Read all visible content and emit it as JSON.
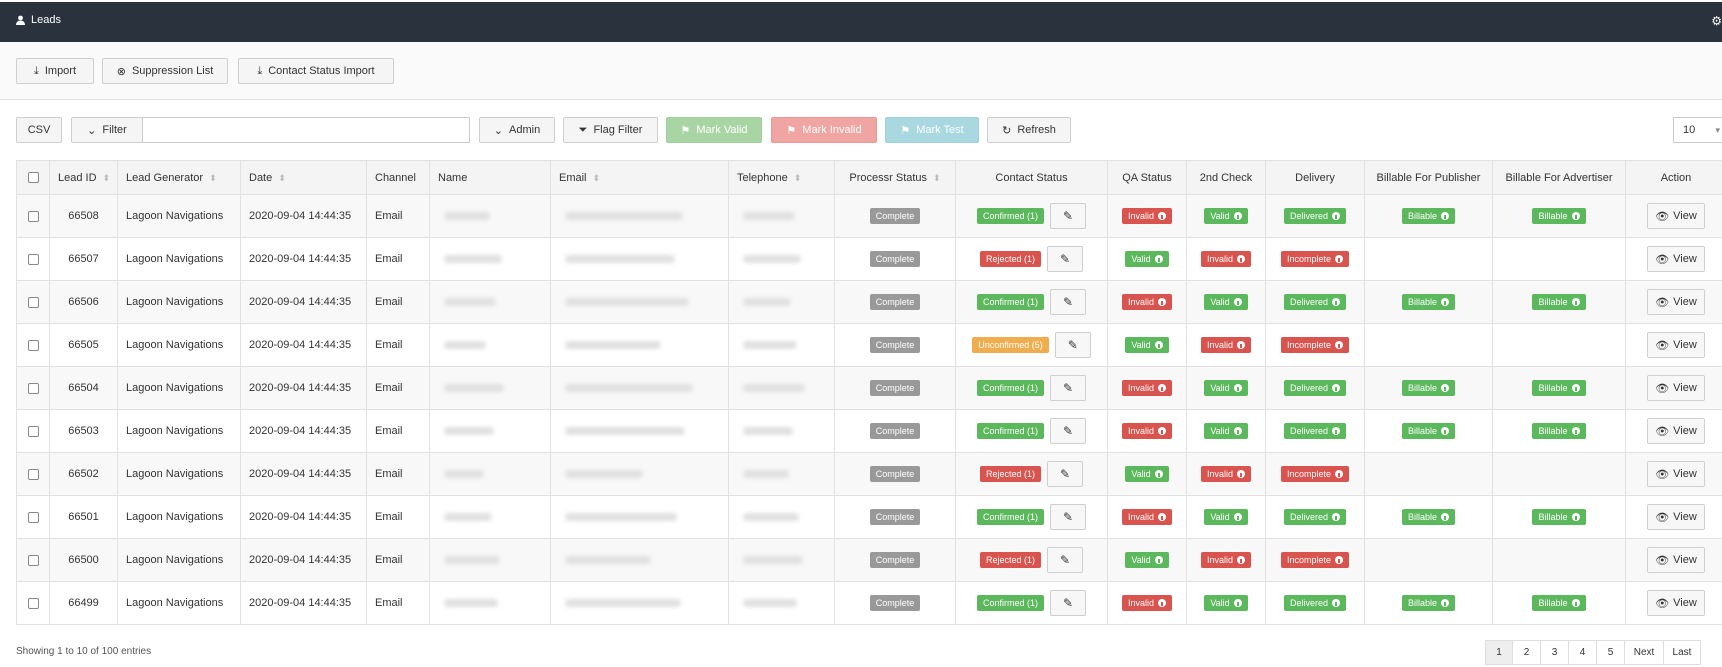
{
  "header": {
    "title": "Leads",
    "user_icon": "user-icon",
    "settings_icon": "gear-icon"
  },
  "actions": {
    "import": "Import",
    "suppression": "Suppression List",
    "contact_status_import": "Contact Status Import"
  },
  "toolbar": {
    "csv": "CSV",
    "filter": "Filter",
    "filter_value": "",
    "admin": "Admin",
    "flag_filter": "Flag Filter",
    "mark_valid": "Mark Valid",
    "mark_invalid": "Mark Invalid",
    "mark_test": "Mark Test",
    "refresh": "Refresh",
    "page_size": "10"
  },
  "colors": {
    "header_bg": "#2a323d",
    "green": "#5cb85c",
    "red": "#d9534f",
    "orange": "#f0ad4e",
    "gray": "#999999"
  },
  "table": {
    "columns": [
      "Lead ID",
      "Lead Generator",
      "Date",
      "Channel",
      "Name",
      "Email",
      "Telephone",
      "Processr Status",
      "Contact Status",
      "QA Status",
      "2nd Check",
      "Delivery",
      "Billable For Publisher",
      "Billable For Advertiser",
      "Action"
    ],
    "rows": [
      {
        "id": "66508",
        "gen": "Lagoon Navigations",
        "date": "2020-09-04 14:44:35",
        "ch": "Email",
        "proc": "Complete",
        "contact": "Confirmed (1)",
        "contact_color": "green",
        "qa": "Invalid",
        "qa_color": "red",
        "check2": "Valid",
        "check2_color": "green",
        "delivery": "Delivered",
        "delivery_color": "green",
        "bill_pub": "Billable",
        "bill_adv": "Billable",
        "action": "View"
      },
      {
        "id": "66507",
        "gen": "Lagoon Navigations",
        "date": "2020-09-04 14:44:35",
        "ch": "Email",
        "proc": "Complete",
        "contact": "Rejected (1)",
        "contact_color": "red",
        "qa": "Valid",
        "qa_color": "green",
        "check2": "Invalid",
        "check2_color": "red",
        "delivery": "Incomplete",
        "delivery_color": "red",
        "bill_pub": "",
        "bill_adv": "",
        "action": "View"
      },
      {
        "id": "66506",
        "gen": "Lagoon Navigations",
        "date": "2020-09-04 14:44:35",
        "ch": "Email",
        "proc": "Complete",
        "contact": "Confirmed (1)",
        "contact_color": "green",
        "qa": "Invalid",
        "qa_color": "red",
        "check2": "Valid",
        "check2_color": "green",
        "delivery": "Delivered",
        "delivery_color": "green",
        "bill_pub": "Billable",
        "bill_adv": "Billable",
        "action": "View"
      },
      {
        "id": "66505",
        "gen": "Lagoon Navigations",
        "date": "2020-09-04 14:44:35",
        "ch": "Email",
        "proc": "Complete",
        "contact": "Unconfirmed (5)",
        "contact_color": "orange",
        "qa": "Valid",
        "qa_color": "green",
        "check2": "Invalid",
        "check2_color": "red",
        "delivery": "Incomplete",
        "delivery_color": "red",
        "bill_pub": "",
        "bill_adv": "",
        "action": "View"
      },
      {
        "id": "66504",
        "gen": "Lagoon Navigations",
        "date": "2020-09-04 14:44:35",
        "ch": "Email",
        "proc": "Complete",
        "contact": "Confirmed (1)",
        "contact_color": "green",
        "qa": "Invalid",
        "qa_color": "red",
        "check2": "Valid",
        "check2_color": "green",
        "delivery": "Delivered",
        "delivery_color": "green",
        "bill_pub": "Billable",
        "bill_adv": "Billable",
        "action": "View"
      },
      {
        "id": "66503",
        "gen": "Lagoon Navigations",
        "date": "2020-09-04 14:44:35",
        "ch": "Email",
        "proc": "Complete",
        "contact": "Confirmed (1)",
        "contact_color": "green",
        "qa": "Invalid",
        "qa_color": "red",
        "check2": "Valid",
        "check2_color": "green",
        "delivery": "Delivered",
        "delivery_color": "green",
        "bill_pub": "Billable",
        "bill_adv": "Billable",
        "action": "View"
      },
      {
        "id": "66502",
        "gen": "Lagoon Navigations",
        "date": "2020-09-04 14:44:35",
        "ch": "Email",
        "proc": "Complete",
        "contact": "Rejected (1)",
        "contact_color": "red",
        "qa": "Valid",
        "qa_color": "green",
        "check2": "Invalid",
        "check2_color": "red",
        "delivery": "Incomplete",
        "delivery_color": "red",
        "bill_pub": "",
        "bill_adv": "",
        "action": "View"
      },
      {
        "id": "66501",
        "gen": "Lagoon Navigations",
        "date": "2020-09-04 14:44:35",
        "ch": "Email",
        "proc": "Complete",
        "contact": "Confirmed (1)",
        "contact_color": "green",
        "qa": "Invalid",
        "qa_color": "red",
        "check2": "Valid",
        "check2_color": "green",
        "delivery": "Delivered",
        "delivery_color": "green",
        "bill_pub": "Billable",
        "bill_adv": "Billable",
        "action": "View"
      },
      {
        "id": "66500",
        "gen": "Lagoon Navigations",
        "date": "2020-09-04 14:44:35",
        "ch": "Email",
        "proc": "Complete",
        "contact": "Rejected (1)",
        "contact_color": "red",
        "qa": "Valid",
        "qa_color": "green",
        "check2": "Invalid",
        "check2_color": "red",
        "delivery": "Incomplete",
        "delivery_color": "red",
        "bill_pub": "",
        "bill_adv": "",
        "action": "View"
      },
      {
        "id": "66499",
        "gen": "Lagoon Navigations",
        "date": "2020-09-04 14:44:35",
        "ch": "Email",
        "proc": "Complete",
        "contact": "Confirmed (1)",
        "contact_color": "green",
        "qa": "Invalid",
        "qa_color": "red",
        "check2": "Valid",
        "check2_color": "green",
        "delivery": "Delivered",
        "delivery_color": "green",
        "bill_pub": "Billable",
        "bill_adv": "Billable",
        "action": "View"
      }
    ]
  },
  "footer": {
    "info": "Showing 1 to 10 of 100 entries",
    "pages": [
      "1",
      "2",
      "3",
      "4",
      "5",
      "Next",
      "Last"
    ]
  }
}
